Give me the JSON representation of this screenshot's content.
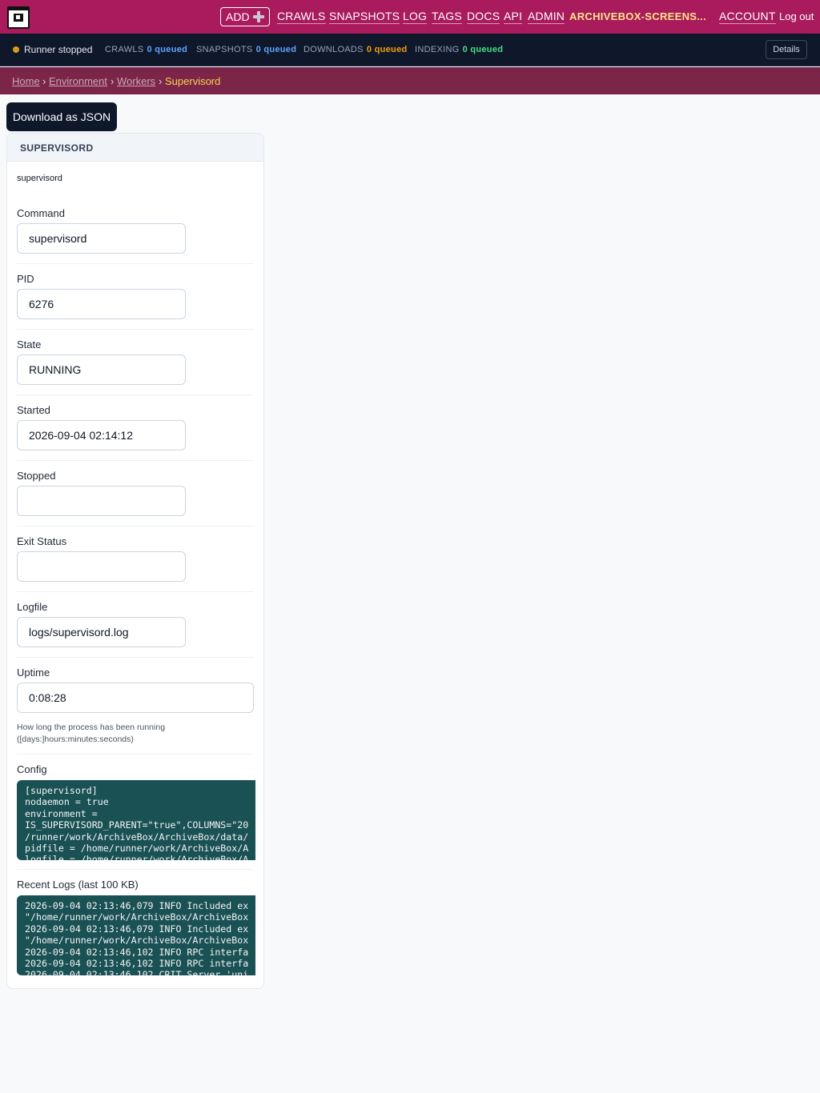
{
  "header": {
    "add_label": "ADD",
    "nav": [
      "CRAWLS",
      "SNAPSHOTS",
      "LOG",
      "TAGS",
      "DOCS",
      "API",
      "ADMIN"
    ],
    "user": "ARCHIVEBOX-SCREENS...",
    "account": "ACCOUNT",
    "logout": "Log out"
  },
  "status": {
    "runner": "Runner stopped",
    "runner_color": "#d69e0e",
    "queues": [
      {
        "label": "CRAWLS",
        "value": "0 queued",
        "color": "#60a5fa"
      },
      {
        "label": "SNAPSHOTS",
        "value": "0 queued",
        "color": "#60a5fa"
      },
      {
        "label": "DOWNLOADS",
        "value": "0 queued",
        "color": "#f59e0b"
      },
      {
        "label": "INDEXING",
        "value": "0 queued",
        "color": "#4ade80"
      }
    ],
    "details": "Details"
  },
  "breadcrumb": {
    "home": "Home",
    "environment": "Environment",
    "workers": "Workers",
    "current": "Supervisord",
    "sep": "›"
  },
  "download_json": "Download as JSON",
  "card": {
    "title": "SUPERVISORD",
    "description": "supervisord",
    "fields": {
      "command": {
        "label": "Command",
        "value": "supervisord"
      },
      "pid": {
        "label": "PID",
        "value": "6276"
      },
      "state": {
        "label": "State",
        "value": "RUNNING"
      },
      "started": {
        "label": "Started",
        "value": "2026-09-04 02:14:12"
      },
      "stopped": {
        "label": "Stopped",
        "value": ""
      },
      "exit_status": {
        "label": "Exit Status",
        "value": ""
      },
      "logfile": {
        "label": "Logfile",
        "value": "logs/supervisord.log"
      },
      "uptime": {
        "label": "Uptime",
        "value": "0:08:28",
        "help": "How long the process has been running ([days:]hours:minutes:seconds)"
      }
    },
    "config": {
      "label": "Config",
      "text": "[supervisord]\nnodaemon = true\nenvironment =\nIS_SUPERVISORD_PARENT=\"true\",COLUMNS=\"20\n/runner/work/ArchiveBox/ArchiveBox/data/\npidfile = /home/runner/work/ArchiveBox/A\nlogfile = /home/runner/work/ArchiveBox/A"
    },
    "logs": {
      "label": "Recent Logs (last 100 KB)",
      "text": "2026-09-04 02:13:46,079 INFO Included ex\n\"/home/runner/work/ArchiveBox/ArchiveBox\n2026-09-04 02:13:46,079 INFO Included ex\n\"/home/runner/work/ArchiveBox/ArchiveBox\n2026-09-04 02:13:46,102 INFO RPC interfa\n2026-09-04 02:13:46,102 INFO RPC interfa\n2026-09-04 02:13:46,102 CRIT Server 'uni"
    }
  }
}
